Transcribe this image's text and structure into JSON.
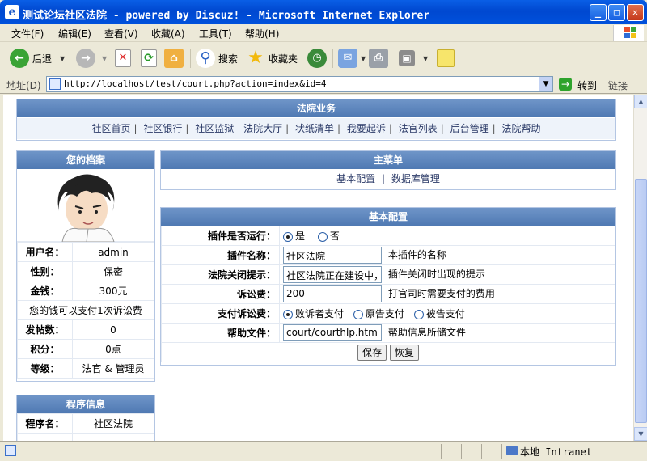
{
  "window": {
    "title": "测试论坛社区法院 - powered by Discuz! - Microsoft Internet Explorer"
  },
  "menu": [
    "文件(F)",
    "编辑(E)",
    "查看(V)",
    "收藏(A)",
    "工具(T)",
    "帮助(H)"
  ],
  "toolbar": {
    "back": "后退",
    "search": "搜索",
    "favorites": "收藏夹"
  },
  "address": {
    "label": "地址(D)",
    "url": "http://localhost/test/court.php?action=index&id=4",
    "go": "转到",
    "links": "链接"
  },
  "status": {
    "zone": "本地 Intranet"
  },
  "court": {
    "title": "法院业务",
    "nav": [
      "社区首页",
      "社区银行",
      "社区监狱",
      "法院大厅",
      "状纸清单",
      "我要起诉",
      "法官列表",
      "后台管理",
      "法院帮助"
    ]
  },
  "profile": {
    "title": "您的档案",
    "rows": [
      {
        "k": "用户名：",
        "v": "admin"
      },
      {
        "k": "性别：",
        "v": "保密"
      },
      {
        "k": "金钱：",
        "v": "300元"
      }
    ],
    "note": "您的钱可以支付1次诉讼费",
    "rows2": [
      {
        "k": "发帖数：",
        "v": "0"
      },
      {
        "k": "积分：",
        "v": "0点"
      },
      {
        "k": "等级：",
        "v": "法官 & 管理员"
      }
    ]
  },
  "program": {
    "title": "程序信息",
    "rows": [
      {
        "k": "程序名：",
        "v": "社区法院"
      }
    ]
  },
  "mainmenu": {
    "title": "主菜单",
    "items": [
      "基本配置",
      "数据库管理"
    ]
  },
  "config": {
    "title": "基本配置",
    "running": {
      "label": "插件是否运行：",
      "yes": "是",
      "no": "否",
      "selected": "是"
    },
    "name": {
      "label": "插件名称：",
      "value": "社区法院",
      "hint": "本插件的名称"
    },
    "closed": {
      "label": "法院关闭提示：",
      "value": "社区法院正在建设中，",
      "hint": "插件关闭时出现的提示"
    },
    "fee": {
      "label": "诉讼费：",
      "value": "200",
      "hint": "打官司时需要支付的费用"
    },
    "payer": {
      "label": "支付诉讼费：",
      "options": [
        "败诉者支付",
        "原告支付",
        "被告支付"
      ],
      "selected": "败诉者支付"
    },
    "help": {
      "label": "帮助文件：",
      "value": "court/courthlp.htm",
      "hint": "帮助信息所储文件"
    },
    "save": "保存",
    "reset": "恢复"
  }
}
